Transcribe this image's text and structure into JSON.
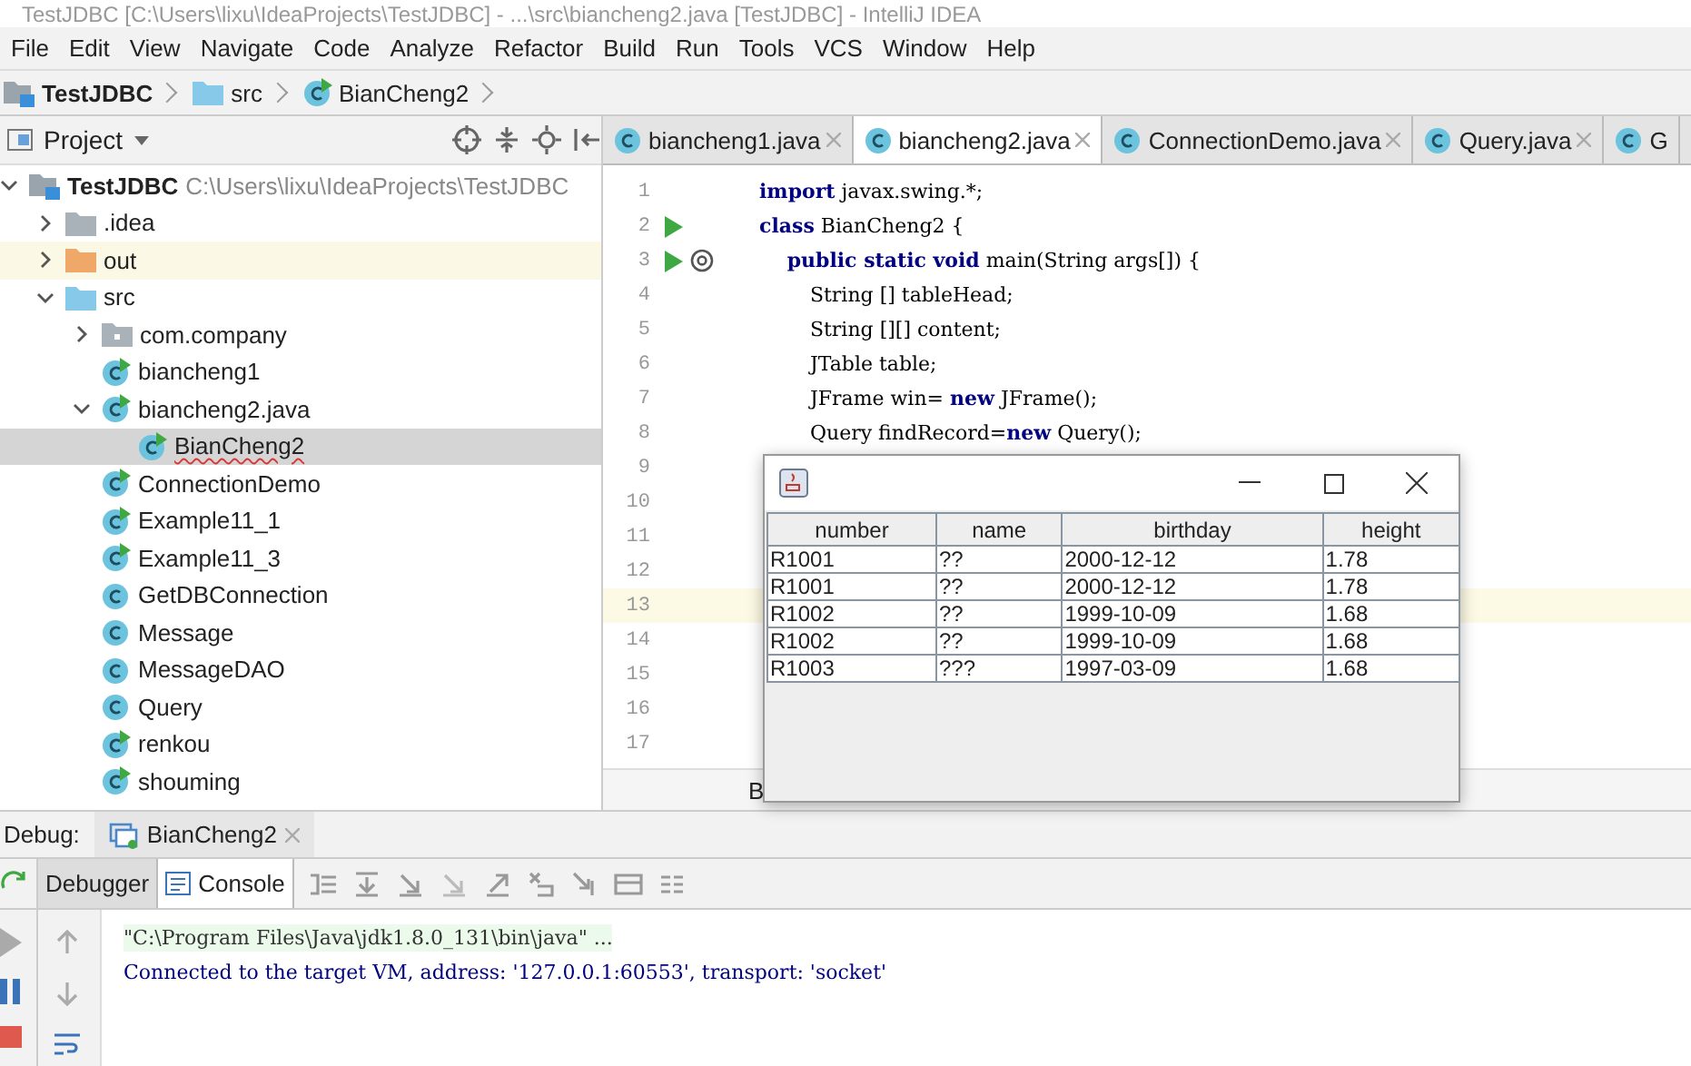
{
  "window": {
    "title": "TestJDBC [C:\\Users\\lixu\\IdeaProjects\\TestJDBC] - ...\\src\\biancheng2.java [TestJDBC] - IntelliJ IDEA"
  },
  "menu": [
    "File",
    "Edit",
    "View",
    "Navigate",
    "Code",
    "Analyze",
    "Refactor",
    "Build",
    "Run",
    "Tools",
    "VCS",
    "Window",
    "Help"
  ],
  "breadcrumbs": [
    {
      "label": "TestJDBC",
      "kind": "project"
    },
    {
      "label": "src",
      "kind": "folder"
    },
    {
      "label": "BianCheng2",
      "kind": "runclass"
    }
  ],
  "project_panel": {
    "title": "Project",
    "tree": [
      {
        "label": "TestJDBC",
        "hint": "C:\\Users\\lixu\\IdeaProjects\\TestJDBC",
        "kind": "project",
        "expanded": true,
        "selected": false,
        "highlighted": false,
        "children": [
          {
            "label": ".idea",
            "kind": "folder-grey",
            "expanded": false,
            "selected": false,
            "highlighted": false
          },
          {
            "label": "out",
            "kind": "folder-orange",
            "expanded": false,
            "selected": false,
            "highlighted": true
          },
          {
            "label": "src",
            "kind": "folder-blue",
            "expanded": true,
            "selected": false,
            "highlighted": false,
            "children": [
              {
                "label": "com.company",
                "kind": "package",
                "expanded": false,
                "selected": false,
                "highlighted": false
              },
              {
                "label": "biancheng1",
                "kind": "runclass",
                "selected": false,
                "highlighted": false
              },
              {
                "label": "biancheng2.java",
                "kind": "runclass",
                "expanded": true,
                "selected": false,
                "highlighted": false,
                "children": [
                  {
                    "label": "BianCheng2",
                    "kind": "runclass",
                    "selected": true,
                    "highlighted": false
                  }
                ]
              },
              {
                "label": "ConnectionDemo",
                "kind": "runclass",
                "selected": false,
                "highlighted": false
              },
              {
                "label": "Example11_1",
                "kind": "runclass",
                "selected": false,
                "highlighted": false
              },
              {
                "label": "Example11_3",
                "kind": "runclass",
                "selected": false,
                "highlighted": false
              },
              {
                "label": "GetDBConnection",
                "kind": "class",
                "selected": false,
                "highlighted": false
              },
              {
                "label": "Message",
                "kind": "class",
                "selected": false,
                "highlighted": false
              },
              {
                "label": "MessageDAO",
                "kind": "class",
                "selected": false,
                "highlighted": false
              },
              {
                "label": "Query",
                "kind": "class",
                "selected": false,
                "highlighted": false
              },
              {
                "label": "renkou",
                "kind": "runclass",
                "selected": false,
                "highlighted": false
              },
              {
                "label": "shouming",
                "kind": "runclass",
                "selected": false,
                "highlighted": false
              }
            ]
          }
        ]
      }
    ]
  },
  "editor_tabs": [
    {
      "label": "biancheng1.java",
      "selected": false
    },
    {
      "label": "biancheng2.java",
      "selected": true
    },
    {
      "label": "ConnectionDemo.java",
      "selected": false
    },
    {
      "label": "Query.java",
      "selected": false
    },
    {
      "label": "G",
      "selected": false
    }
  ],
  "code_lines": [
    {
      "number": "1",
      "kind": "plain",
      "current": false,
      "tokens": [
        {
          "text": "import",
          "kind": "kw"
        },
        {
          "text": " javax.swing.*;",
          "kind": "plain"
        }
      ]
    },
    {
      "number": "2",
      "kind": "run",
      "current": false,
      "tokens": [
        {
          "text": "class",
          "kind": "kw"
        },
        {
          "text": " BianCheng2 {",
          "kind": "plain"
        }
      ]
    },
    {
      "number": "3",
      "kind": "run-override",
      "current": false,
      "tokens": [
        {
          "text": "    public static void",
          "kind": "kw"
        },
        {
          "text": " main(String args[]) {",
          "kind": "plain"
        }
      ]
    },
    {
      "number": "4",
      "kind": "plain",
      "current": false,
      "tokens": [
        {
          "text": "        String [] tableHead;",
          "kind": "plain"
        }
      ]
    },
    {
      "number": "5",
      "kind": "plain",
      "current": false,
      "tokens": [
        {
          "text": "        String [][] content;",
          "kind": "plain"
        }
      ]
    },
    {
      "number": "6",
      "kind": "plain",
      "current": false,
      "tokens": [
        {
          "text": "        JTable table;",
          "kind": "plain"
        }
      ]
    },
    {
      "number": "7",
      "kind": "plain",
      "current": false,
      "tokens": [
        {
          "text": "        JFrame win= ",
          "kind": "plain"
        },
        {
          "text": "new",
          "kind": "kw"
        },
        {
          "text": " JFrame();",
          "kind": "plain"
        }
      ]
    },
    {
      "number": "8",
      "kind": "plain",
      "current": false,
      "tokens": [
        {
          "text": "        Query findRecord=",
          "kind": "plain"
        },
        {
          "text": "new",
          "kind": "kw"
        },
        {
          "text": " Query();",
          "kind": "plain"
        }
      ]
    },
    {
      "number": "9",
      "kind": "plain",
      "current": false
    },
    {
      "number": "10",
      "kind": "plain",
      "current": false
    },
    {
      "number": "11",
      "kind": "plain",
      "current": false
    },
    {
      "number": "12",
      "kind": "plain",
      "current": false
    },
    {
      "number": "13",
      "kind": "plain",
      "current": true
    },
    {
      "number": "14",
      "kind": "plain",
      "current": false
    },
    {
      "number": "15",
      "kind": "plain",
      "current": false
    },
    {
      "number": "16",
      "kind": "plain",
      "current": false
    },
    {
      "number": "17",
      "kind": "plain",
      "current": false
    }
  ],
  "editor_breadcrumb": "B",
  "java_window": {
    "table": {
      "columns": [
        "number",
        "name",
        "birthday",
        "height"
      ],
      "rows": [
        [
          "R1001",
          "??",
          "2000-12-12",
          "1.78"
        ],
        [
          "R1001",
          "??",
          "2000-12-12",
          "1.78"
        ],
        [
          "R1002",
          "??",
          "1999-10-09",
          "1.68"
        ],
        [
          "R1002",
          "??",
          "1999-10-09",
          "1.68"
        ],
        [
          "R1003",
          "???",
          "1997-03-09",
          "1.68"
        ]
      ]
    }
  },
  "debug": {
    "label": "Debug:",
    "session": "BianCheng2",
    "tabs": [
      {
        "label": "Debugger",
        "selected": false
      },
      {
        "label": "Console",
        "selected": true
      }
    ],
    "console": [
      {
        "text": "\"C:\\Program Files\\Java\\jdk1.8.0_131\\bin\\java\" ...",
        "kind": "command"
      },
      {
        "text": "Connected to the target VM, address: '127.0.0.1:60553', transport: 'socket'",
        "kind": "info"
      }
    ]
  }
}
